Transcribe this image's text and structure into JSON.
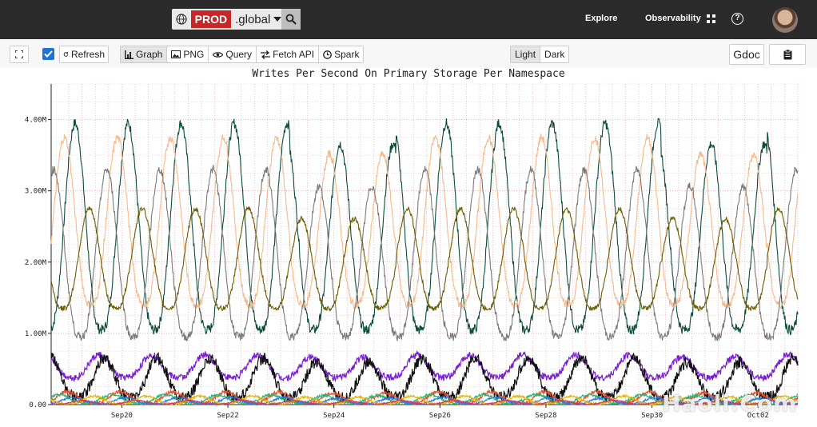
{
  "header": {
    "env_label": "PROD",
    "region_label": ".global",
    "explore_label": "Explore",
    "observability_label": "Observability",
    "help_glyph": "?"
  },
  "toolbar": {
    "refresh_label": "Refresh",
    "refresh_checked": true,
    "view_buttons": [
      "Graph",
      "PNG",
      "Query",
      "Fetch API",
      "Spark"
    ],
    "theme_buttons": [
      "Light",
      "Dark"
    ],
    "gdoc_label": "Gdoc"
  },
  "icons": [
    "expand-icon",
    "globe-icon",
    "search-icon",
    "apps-grid-icon",
    "help-icon",
    "refresh-icon",
    "bar-chart-icon",
    "image-icon",
    "eye-icon",
    "swap-icon",
    "clock-icon",
    "clipboard-icon"
  ],
  "colors": {
    "prod_red": "#c62828",
    "topbar": "#2b2b2b",
    "checkbox_blue": "#1e74d6"
  },
  "watermark": "Haoli.Com",
  "chart_data": {
    "type": "line",
    "title": "Writes Per Second On Primary Storage Per Namespace",
    "xlabel": "",
    "ylabel": "",
    "x_ticks": [
      "Sep20",
      "Sep22",
      "Sep24",
      "Sep26",
      "Sep28",
      "Sep30",
      "Oct02"
    ],
    "y_ticks": [
      "0.00",
      "1.00M",
      "2.00M",
      "3.00M",
      "4.00M"
    ],
    "ylim": [
      0,
      4500000
    ],
    "x_range_days": [
      "Sep18 16:00",
      "Oct02 18:00"
    ],
    "grid": true,
    "legend": "none",
    "series": [
      {
        "color": "#0b4d3a",
        "min": 1050000,
        "max": 3950000,
        "period_days": 1,
        "phase": 0.05
      },
      {
        "color": "#f5b98a",
        "min": 1400000,
        "max": 3750000,
        "period_days": 1,
        "phase": 0.25
      },
      {
        "color": "#7a7a7a",
        "min": 950000,
        "max": 3300000,
        "period_days": 1,
        "phase": 0.45
      },
      {
        "color": "#6b5d00",
        "min": 1350000,
        "max": 2750000,
        "period_days": 1,
        "phase": 0.78
      },
      {
        "color": "#7a1fd1",
        "min": 380000,
        "max": 700000,
        "period_days": 1,
        "phase": 0.6
      },
      {
        "color": "#111111",
        "min": 100000,
        "max": 650000,
        "period_days": 1,
        "phase": 0.5
      },
      {
        "color": "#e8542a",
        "min": 20000,
        "max": 180000,
        "period_days": 1,
        "phase": 0.2
      },
      {
        "color": "#22b573",
        "min": 20000,
        "max": 140000,
        "period_days": 1,
        "phase": 0.35
      },
      {
        "color": "#2a7ae2",
        "min": 10000,
        "max": 100000,
        "period_days": 1,
        "phase": 0.1
      },
      {
        "color": "#e3b400",
        "min": 10000,
        "max": 120000,
        "period_days": 1,
        "phase": 0.7
      },
      {
        "color": "#d6336c",
        "min": 5000,
        "max": 60000,
        "period_days": 1,
        "phase": 0.9
      }
    ]
  }
}
